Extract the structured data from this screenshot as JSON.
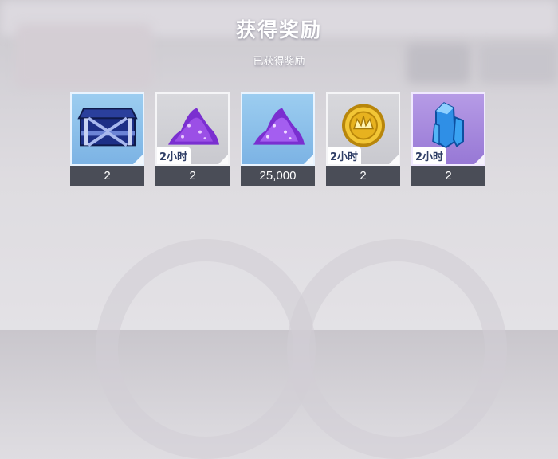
{
  "header": {
    "title": "获得奖励",
    "subtitle": "已获得奖励"
  },
  "rewards": [
    {
      "icon": "blue-treasure-chest-icon",
      "rarity_color": "#8cc2ec",
      "badge": "",
      "count": "2"
    },
    {
      "icon": "purple-crystal-pile-icon",
      "rarity_color": "#d1d1d5",
      "badge": "2小时",
      "count": "2"
    },
    {
      "icon": "purple-crystal-pile-icon",
      "rarity_color": "#8cc2ec",
      "badge": "",
      "count": "25,000"
    },
    {
      "icon": "gold-coin-icon",
      "rarity_color": "#d1d1d5",
      "badge": "2小时",
      "count": "2"
    },
    {
      "icon": "blue-crystal-shard-icon",
      "rarity_color": "#a78ade",
      "badge": "2小时",
      "count": "2"
    }
  ]
}
